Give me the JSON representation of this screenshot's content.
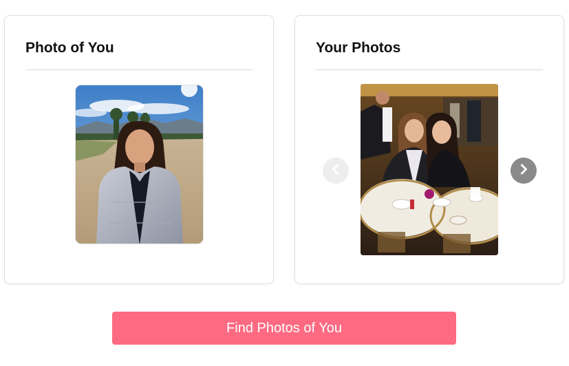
{
  "photo_of_you": {
    "title": "Photo of You",
    "image_icon": "portrait-photo"
  },
  "your_photos": {
    "title": "Your Photos",
    "image_icon": "gallery-photo",
    "prev_icon": "chevron-left-icon",
    "next_icon": "chevron-right-icon"
  },
  "actions": {
    "find_label": "Find Photos of You"
  },
  "colors": {
    "accent": "#fd6a82",
    "prev_button_disabled": "#eeeeee",
    "next_button": "#8a8a8a"
  }
}
